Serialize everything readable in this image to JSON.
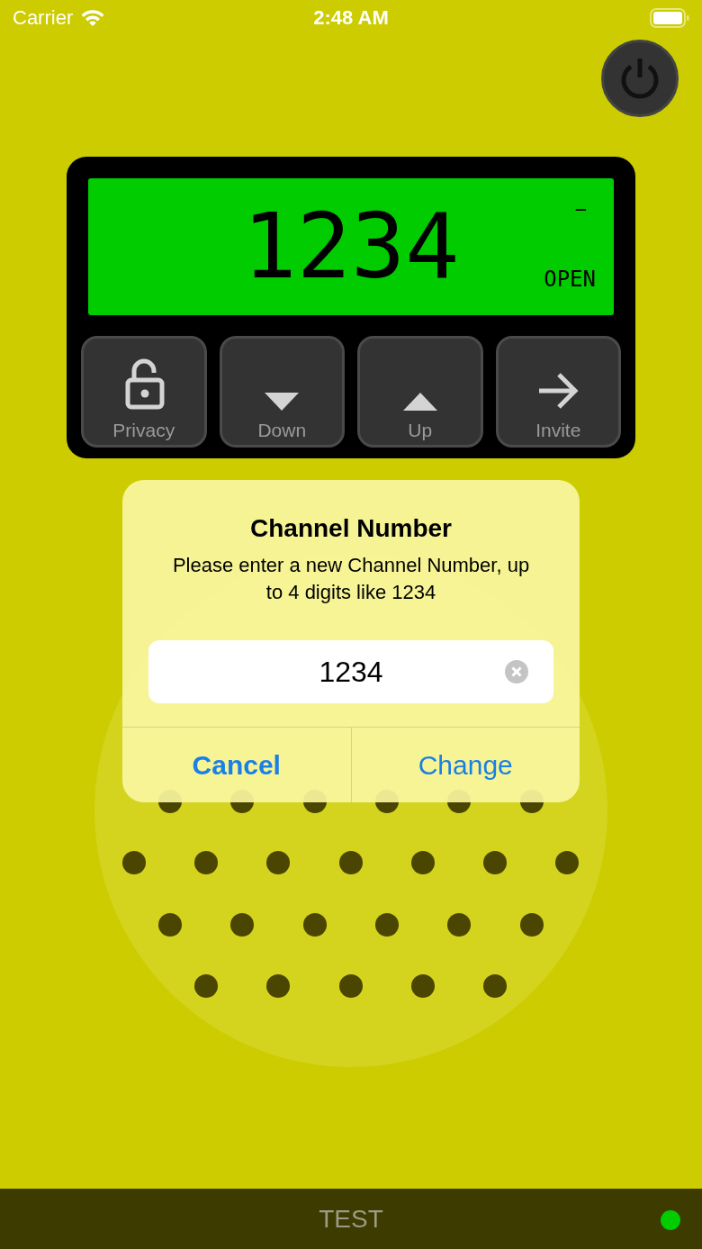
{
  "status_bar": {
    "carrier": "Carrier",
    "time": "2:48 AM"
  },
  "power_button": {
    "on": false
  },
  "display": {
    "channel": "1234",
    "indicator": "−",
    "state": "OPEN"
  },
  "controls": [
    {
      "label": "Privacy",
      "kind": "lock"
    },
    {
      "label": "Down",
      "kind": "down"
    },
    {
      "label": "Up",
      "kind": "up"
    },
    {
      "label": "Invite",
      "kind": "arrow"
    }
  ],
  "dialog": {
    "title": "Channel Number",
    "message": "Please enter a new Channel Number, up to 4 digits like 1234",
    "field": {
      "value": "1234"
    },
    "buttons": [
      {
        "label": "Cancel",
        "kind": "cancel"
      },
      {
        "label": "Change",
        "kind": "default"
      }
    ]
  },
  "bottom_bar": {
    "label": "TEST",
    "online": true
  }
}
